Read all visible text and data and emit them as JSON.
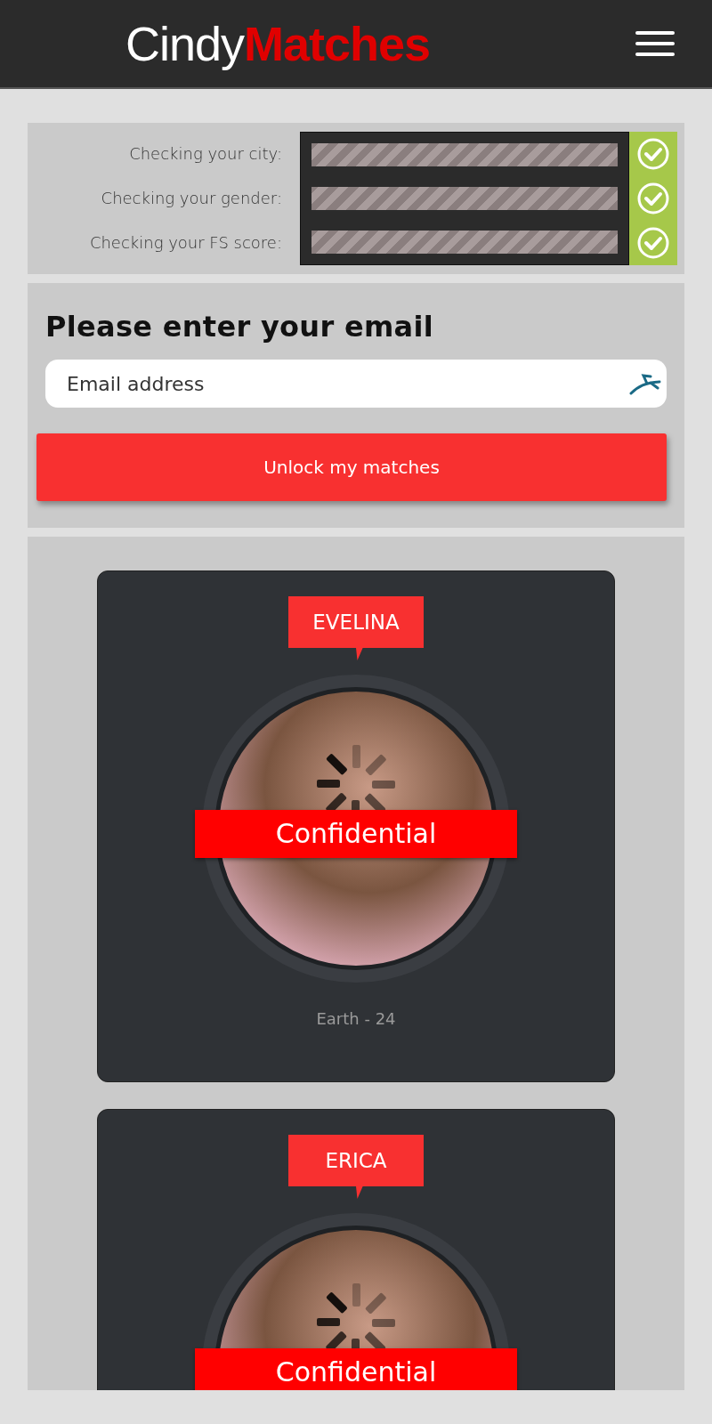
{
  "header": {
    "logo": "Cindy**Matches**"
  },
  "checks": [
    {
      "label": "Checking your city:",
      "checked": true
    },
    {
      "label": "Checking your gender:",
      "checked": true
    },
    {
      "label": "Checking your FS score:",
      "checked": true
    }
  ],
  "email_form": {
    "title": "Please enter your email",
    "placeholder": "Email address",
    "button": "Unlock my matches"
  },
  "matches": [
    {
      "name": "EVELINA",
      "badge": "Confidential",
      "location": "Earth - 24"
    },
    {
      "name": "ERICA",
      "badge": "Confidential"
    }
  ]
}
